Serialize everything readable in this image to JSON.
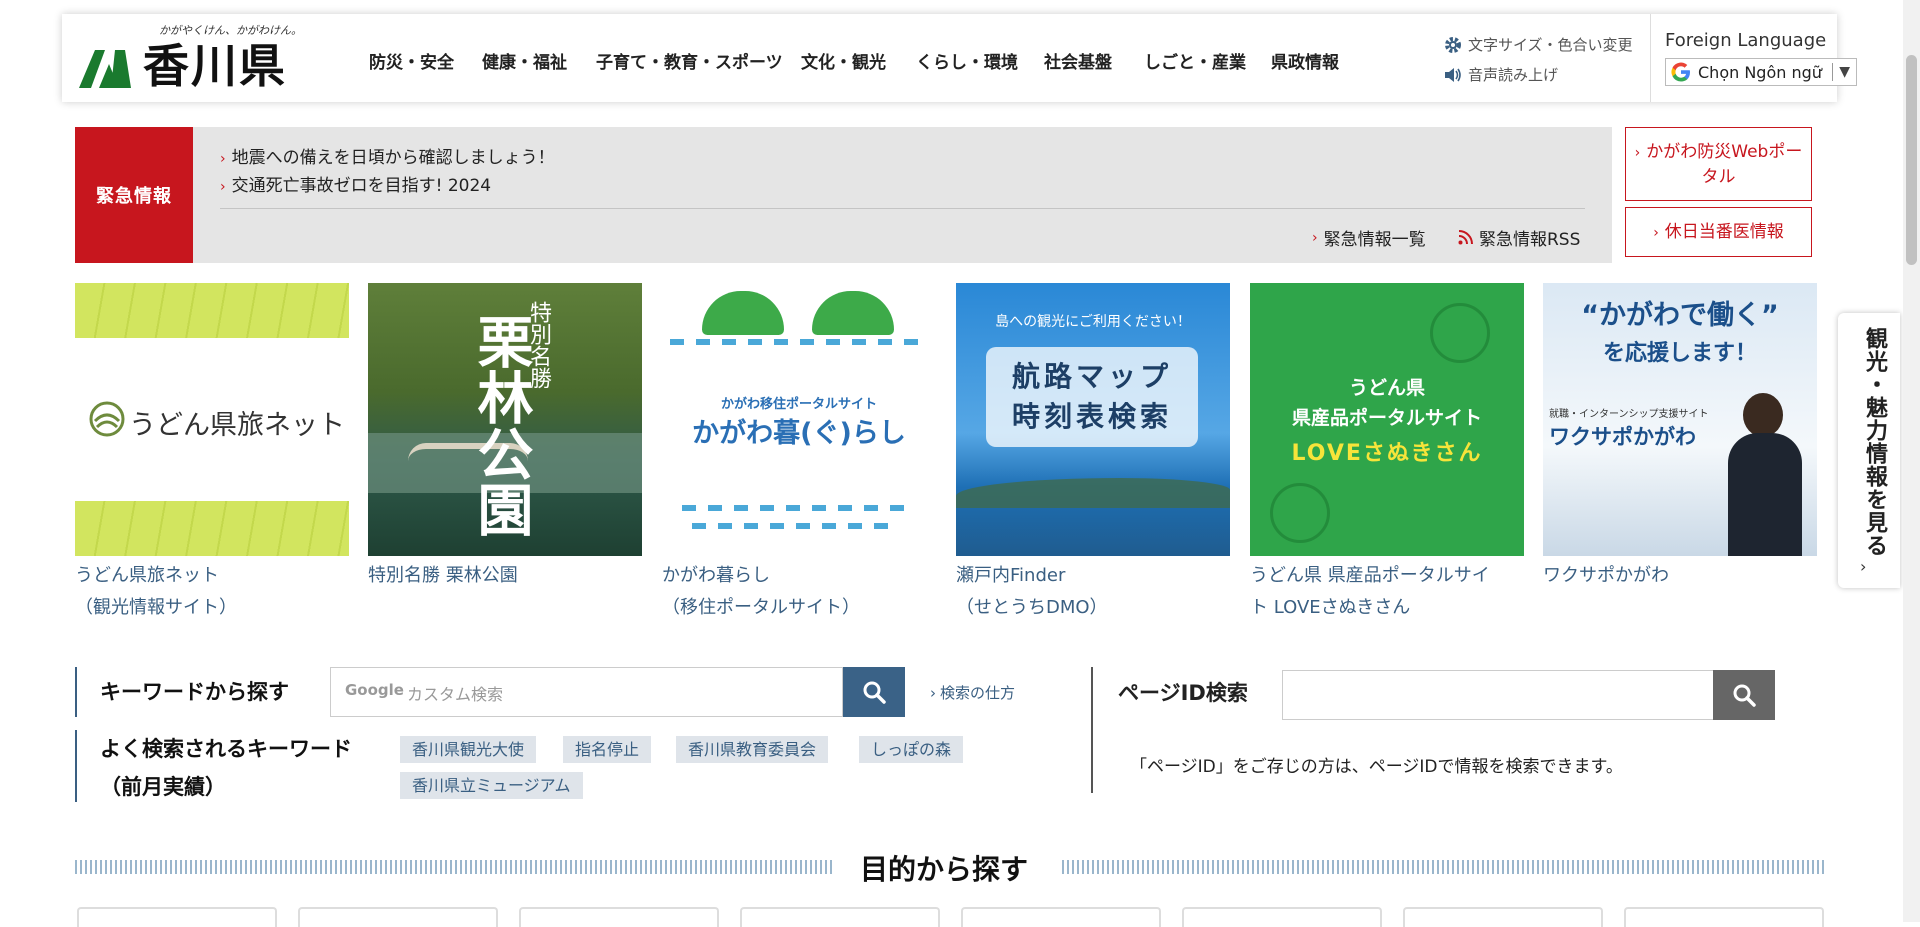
{
  "header": {
    "logo_tagline": "かがやくけん、かがわけん。",
    "logo_text": "香川県",
    "nav": [
      "防災・安全",
      "健康・福祉",
      "子育て・教育・スポーツ",
      "文化・観光",
      "くらし・環境",
      "社会基盤",
      "しごと・産業",
      "県政情報"
    ],
    "text_size_label": "文字サイズ・色合い変更",
    "read_aloud_label": "音声読み上げ",
    "foreign_language_label": "Foreign Language",
    "language_select_value": "Chọn Ngôn ngữ"
  },
  "emergency": {
    "label": "緊急情報",
    "links": [
      "地震への備えを日頃から確認しましょう！",
      "交通死亡事故ゼロを目指す! 2024"
    ],
    "list_label": "緊急情報一覧",
    "rss_label": "緊急情報RSS"
  },
  "side_buttons": [
    "かがわ防災Webポータル",
    "休日当番医情報"
  ],
  "banners": [
    {
      "caption_line1": "うどん県旅ネット",
      "caption_line2": "（観光情報サイト）",
      "image_text": "うどん県旅ネット"
    },
    {
      "caption_line1": "特別名勝 栗林公園",
      "caption_line2": "",
      "image_text_small": "特別名勝",
      "image_text_big": "栗林公園"
    },
    {
      "caption_line1": "かがわ暮らし",
      "caption_line2": "（移住ポータルサイト）",
      "image_text_small": "かがわ移住ポータルサイト",
      "image_text_big": "かがわ暮(ぐ)らし"
    },
    {
      "caption_line1": "瀬戸内Finder",
      "caption_line2": "（せとうちDMO）",
      "image_text_small": "島への観光にご利用ください！",
      "image_text_big1": "航路マップ",
      "image_text_big2": "時刻表検索"
    },
    {
      "caption_line1": "うどん県 県産品ポータルサイ",
      "caption_line2": "ト LOVEさぬきさん",
      "image_text1": "うどん県",
      "image_text2": "県産品ポータルサイト",
      "image_text3": "LOVEさぬきさん"
    },
    {
      "caption_line1": "ワクサポかがわ",
      "caption_line2": "",
      "image_text1": "“かがわで働く”",
      "image_text2": "を応援します！",
      "image_text3": "就職・インターンシップ支援サイト",
      "image_text4": "ワクサポかがわ"
    }
  ],
  "side_tab": {
    "label": "観光・魅力情報を見る"
  },
  "search": {
    "keyword_title": "キーワードから探す",
    "placeholder_brand": "Google",
    "placeholder": "カスタム検索",
    "howto_label": "検索の仕方",
    "frequent_title_line1": "よく検索されるキーワード",
    "frequent_title_line2": "（前月実績）",
    "tags": [
      "香川県観光大使",
      "指名停止",
      "香川県教育委員会",
      "しっぽの森",
      "香川県立ミュージアム"
    ]
  },
  "page_id": {
    "title": "ページID検索",
    "description": "「ページID」をご存じの方は、ページIDで情報を検索できます。"
  },
  "purpose": {
    "title": "目的から探す"
  },
  "colors": {
    "accent_red": "#c7161e",
    "link_blue": "#3a5f82",
    "search_blue": "#3a6287"
  }
}
